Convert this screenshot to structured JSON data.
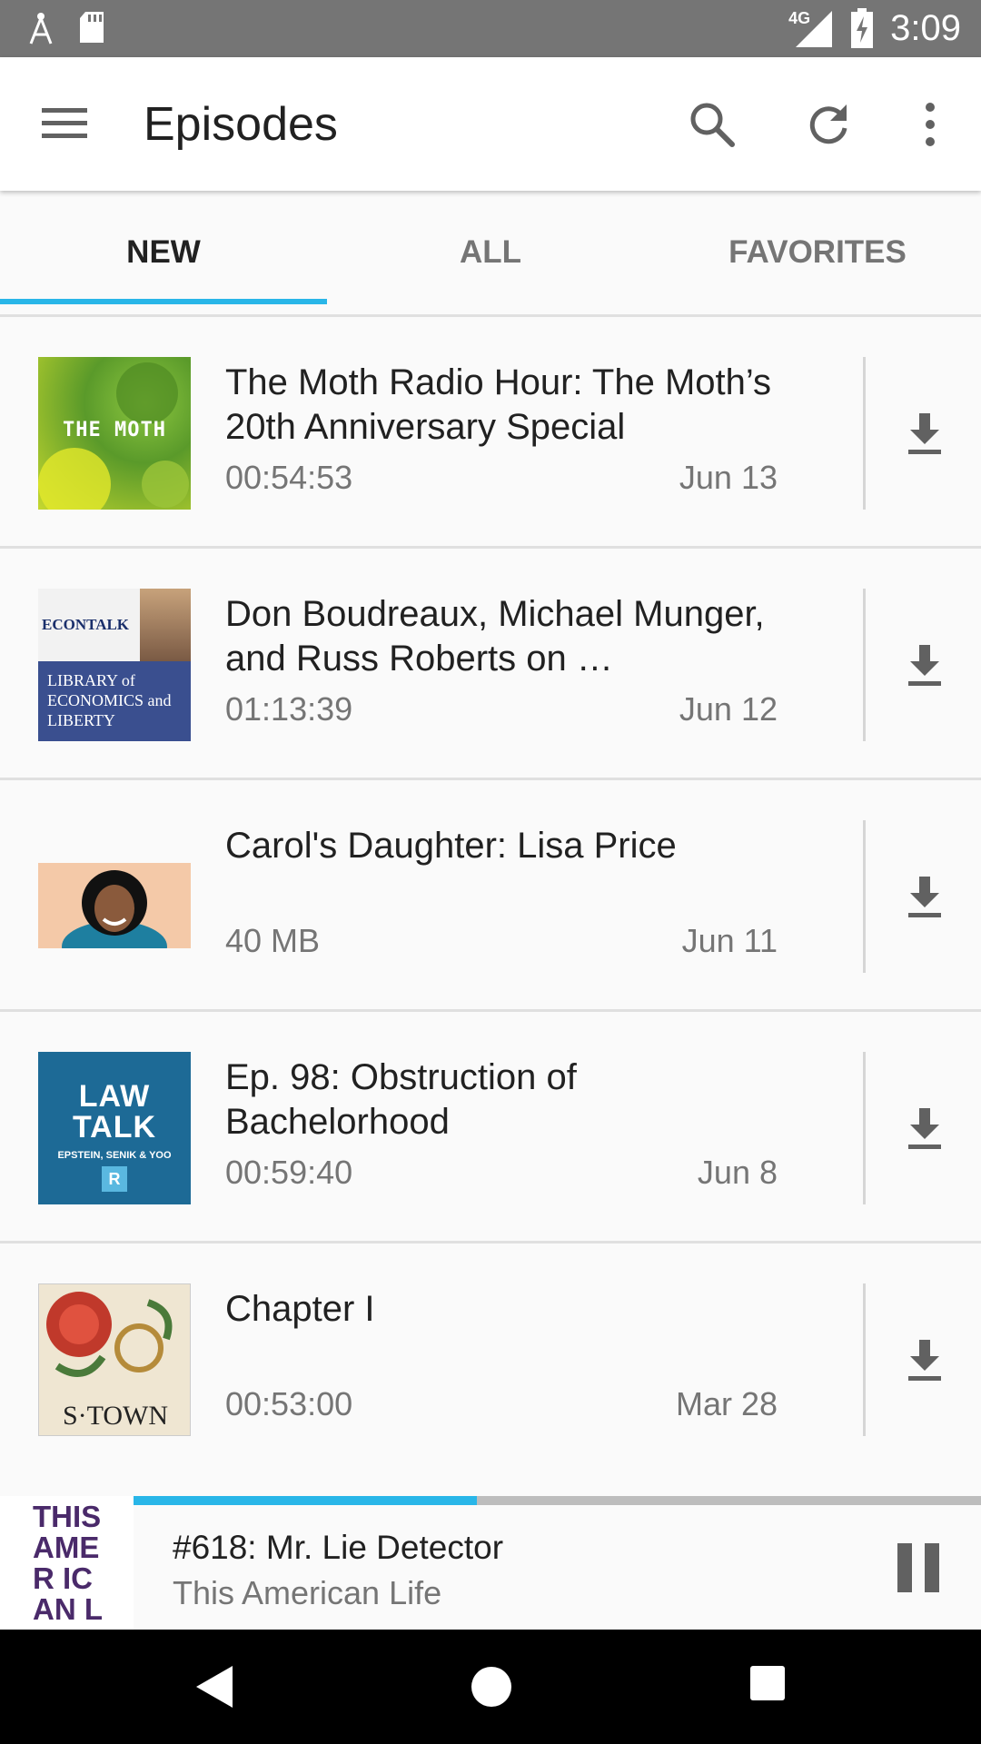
{
  "status_bar": {
    "time": "3:09",
    "network": "4G"
  },
  "app_bar": {
    "title": "Episodes"
  },
  "tabs": [
    {
      "label": "NEW",
      "active": true
    },
    {
      "label": "ALL",
      "active": false
    },
    {
      "label": "FAVORITES",
      "active": false
    }
  ],
  "episodes": [
    {
      "title": "The Moth Radio Hour: The Moth’s 20th Anniversary Special",
      "meta": "00:54:53",
      "date": "Jun 13",
      "art_text": "THE MOTH"
    },
    {
      "title": "Don Boudreaux, Michael Munger, and Russ Roberts on …",
      "meta": "01:13:39",
      "date": "Jun 12",
      "art_text": "ECONTALK",
      "art_text2": "LIBRARY of ECONOMICS and LIBERTY"
    },
    {
      "title": "Carol's Daughter: Lisa Price",
      "meta": "40 MB",
      "date": "Jun 11"
    },
    {
      "title": "Ep. 98: Obstruction of Bachelorhood",
      "meta": "00:59:40",
      "date": "Jun 8",
      "art_text": "LAW TALK",
      "art_text2": "EPSTEIN, SENIK & YOO"
    },
    {
      "title": "Chapter I",
      "meta": "00:53:00",
      "date": "Mar 28",
      "art_text": "S·TOWN"
    }
  ],
  "player": {
    "episode_title": "#618: Mr. Lie Detector",
    "show": "This American Life",
    "progress": 0.405,
    "art_text": "THIS AMER ICAN LIFE"
  },
  "colors": {
    "accent": "#29b6e8",
    "status_bar": "#757575"
  }
}
